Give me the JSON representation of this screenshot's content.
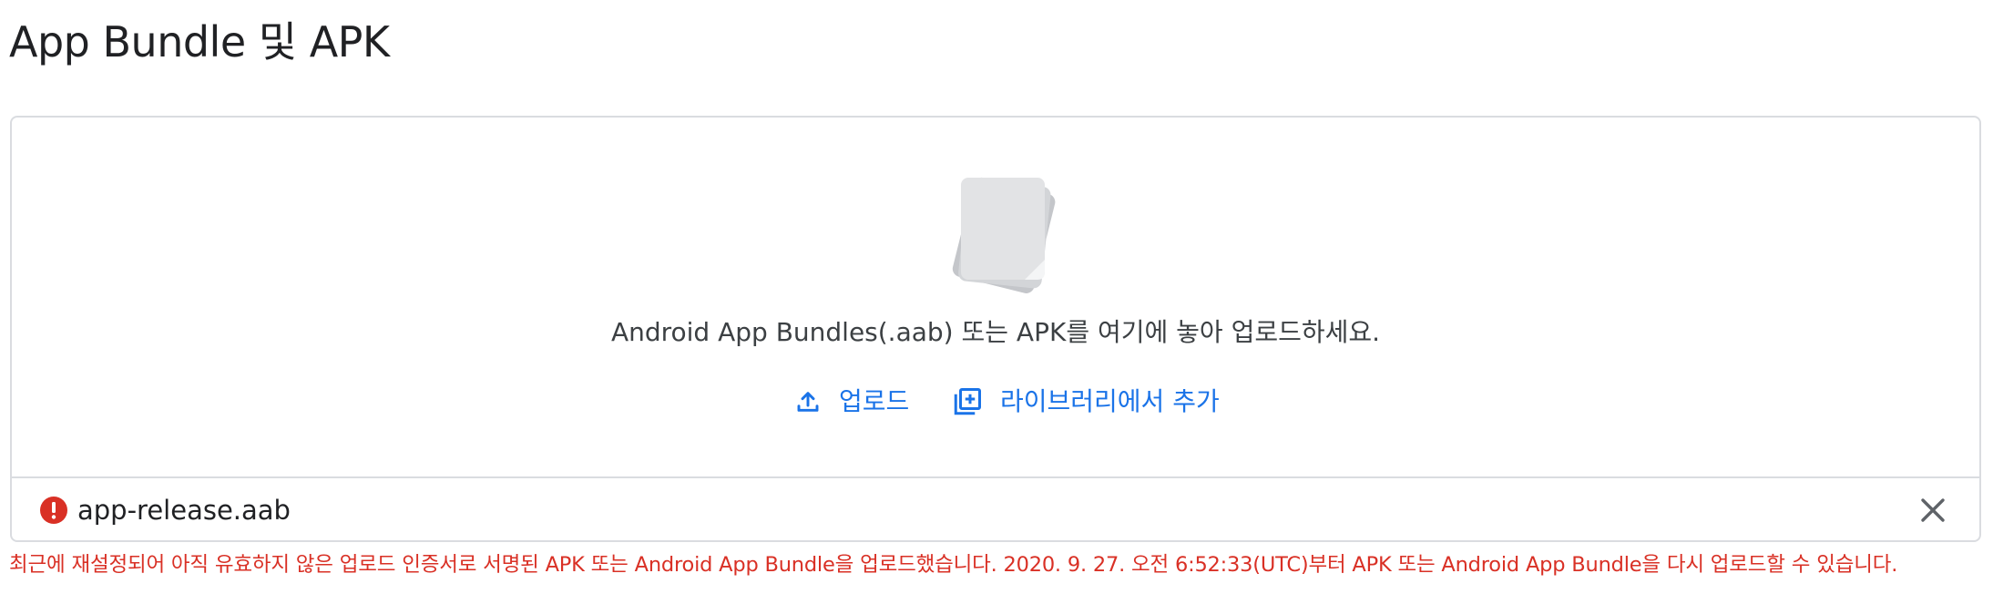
{
  "page": {
    "title": "App Bundle 및 APK"
  },
  "dropzone": {
    "instruction": "Android App Bundles(.aab) 또는 APK를 여기에 놓아 업로드하세요.",
    "upload_label": "업로드",
    "library_label": "라이브러리에서 추가"
  },
  "file": {
    "name": "app-release.aab",
    "status": "error"
  },
  "error": {
    "message": "최근에 재설정되어 아직 유효하지 않은 업로드 인증서로 서명된 APK 또는 Android App Bundle을 업로드했습니다. 2020. 9. 27. 오전 6:52:33(UTC)부터 APK 또는 Android App Bundle을 다시 업로드할 수 있습니다."
  },
  "colors": {
    "accent": "#1a73e8",
    "error": "#d93025",
    "border": "#dadce0"
  },
  "icons": {
    "document": "document-stack-icon",
    "upload": "upload-icon",
    "library": "library-add-icon",
    "error": "error-icon",
    "close": "close-icon"
  }
}
